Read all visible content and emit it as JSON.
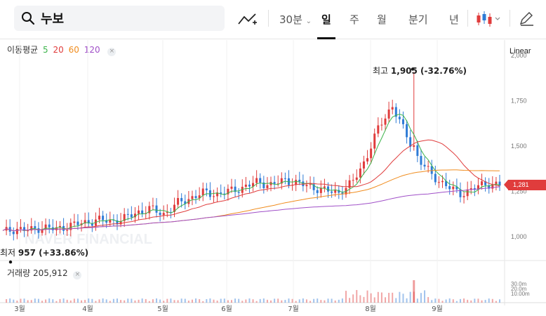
{
  "search": {
    "value": "누보",
    "icon": "search-icon"
  },
  "toolbar": {
    "chart_type_icon": "line-chart-plus-icon",
    "interval_30m": "30분",
    "period_day": "일",
    "period_week": "주",
    "period_month": "월",
    "period_quarter": "분기",
    "period_year": "년",
    "candle_style_icon": "candlestick-icon",
    "draw_icon": "pencil-icon",
    "active_period": "일"
  },
  "legend": {
    "label": "이동평균",
    "ma5": "5",
    "ma20": "20",
    "ma60": "60",
    "ma120": "120",
    "ma5_color": "#3cb44b",
    "ma20_color": "#e03c3c",
    "ma60_color": "#f08c1e",
    "ma120_color": "#a050c8"
  },
  "volume_legend": {
    "label": "거래량",
    "value": "205,912"
  },
  "scale_mode": "Linear",
  "current_price": "1,281",
  "annotations": {
    "high_label": "최고",
    "high_value": "1,905 (-32.76%)",
    "low_label": "최저",
    "low_value": "957 (+33.86%)"
  },
  "watermark": "NAVER FINANCIAL",
  "colors": {
    "up": "#e03c3c",
    "down": "#2e7bd6",
    "accent": "#e03c3c"
  },
  "chart_data": {
    "type": "candlestick",
    "y_ticks": [
      "2,000",
      "1,750",
      "1,500",
      "1,250",
      "1,000"
    ],
    "ylim": [
      880,
      2050
    ],
    "volume_ticks": [
      "30.0m",
      "20.0m",
      "10.00m"
    ],
    "x_ticks": [
      "3월",
      "4월",
      "5월",
      "6월",
      "7월",
      "8월",
      "9월"
    ],
    "high": 1905,
    "low": 957,
    "last": 1281,
    "closes_by_week": [
      1020,
      1040,
      1030,
      1050,
      1035,
      1060,
      1070,
      1090,
      1080,
      1095,
      1130,
      1150,
      1120,
      1180,
      1210,
      1240,
      1230,
      1250,
      1270,
      1300,
      1280,
      1310,
      1290,
      1270,
      1250,
      1240,
      1290,
      1420,
      1600,
      1720,
      1560,
      1420,
      1330,
      1280,
      1230,
      1260,
      1290,
      1281
    ]
  }
}
